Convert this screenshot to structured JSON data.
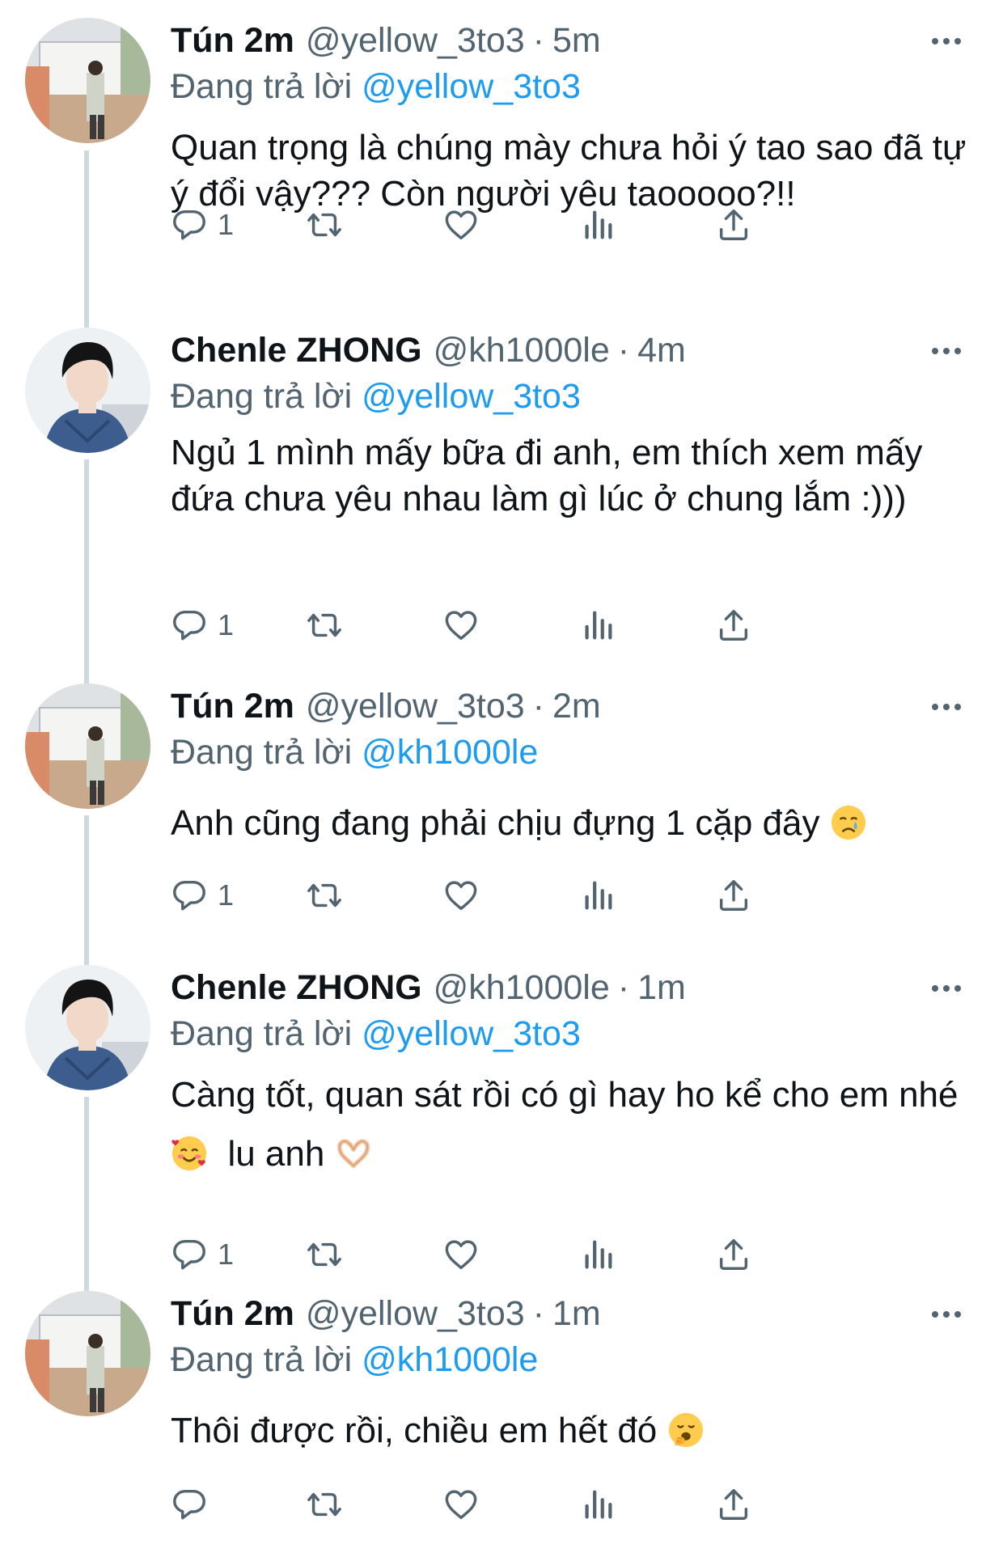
{
  "tweets": [
    {
      "name": "Tún 2m",
      "handle": "@yellow_3to3",
      "separator": "·",
      "time": "5m",
      "reply_prefix": "Đang trả lời",
      "reply_mention": "@yellow_3to3",
      "text": "Quan trọng là chúng mày chưa hỏi ý tao sao đã tự ý đổi vậy??? Còn người yêu taooooo?!!",
      "reply_count": "1",
      "avatar": "avatar-tun"
    },
    {
      "name": "Chenle ZHONG",
      "handle": "@kh1000le",
      "separator": "·",
      "time": "4m",
      "reply_prefix": "Đang trả lời",
      "reply_mention": "@yellow_3to3",
      "text": "Ngủ 1 mình mấy bữa đi anh, em thích xem mấy đứa chưa yêu nhau làm gì lúc ở chung lắm :)))",
      "reply_count": "1",
      "avatar": "avatar-chenle"
    },
    {
      "name": "Tún 2m",
      "handle": "@yellow_3to3",
      "separator": "·",
      "time": "2m",
      "reply_prefix": "Đang trả lời",
      "reply_mention": "@kh1000le",
      "text": "Anh cũng đang phải chịu đựng 1 cặp đây",
      "emoji": "crying-face-emoji",
      "reply_count": "1",
      "avatar": "avatar-tun"
    },
    {
      "name": "Chenle ZHONG",
      "handle": "@kh1000le",
      "separator": "·",
      "time": "1m",
      "reply_prefix": "Đang trả lời",
      "reply_mention": "@yellow_3to3",
      "text_part1": "Càng tốt, quan sát rồi có gì hay ho kể cho em nhé",
      "text_part2": "lu anh",
      "emoji": "smiling-face-with-hearts-emoji",
      "emoji2": "heart-hands-emoji",
      "reply_count": "1",
      "avatar": "avatar-chenle"
    },
    {
      "name": "Tún 2m",
      "handle": "@yellow_3to3",
      "separator": "·",
      "time": "1m",
      "reply_prefix": "Đang trả lời",
      "reply_mention": "@kh1000le",
      "text": "Thôi được rồi, chiều em hết đó",
      "emoji": "yawning-face-emoji",
      "reply_count": "",
      "avatar": "avatar-tun"
    }
  ],
  "icons": {
    "reply": "reply-icon",
    "retweet": "retweet-icon",
    "like": "heart-icon",
    "analytics": "analytics-icon",
    "share": "share-icon",
    "more": "more-icon"
  },
  "colors": {
    "link": "#1d9bf0",
    "secondary_text": "#536471",
    "primary_text": "#0f1419",
    "thread_line": "#cfd9de"
  }
}
